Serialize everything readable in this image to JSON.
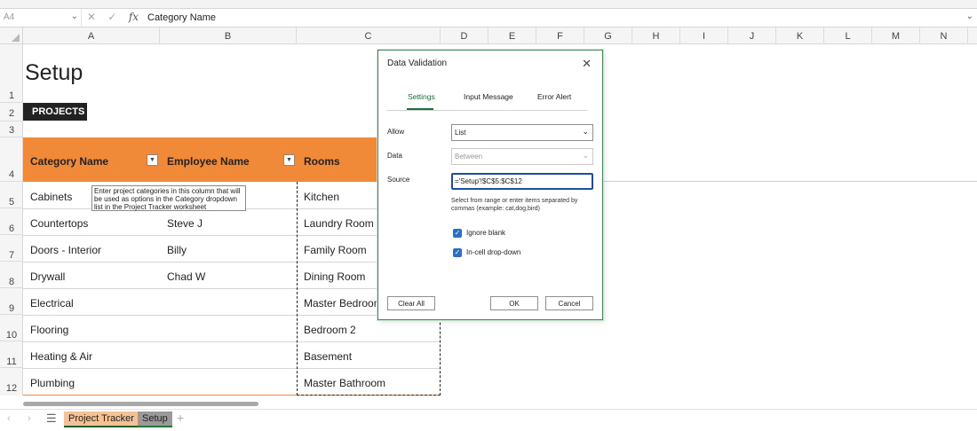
{
  "formula_bar": {
    "cell_ref": "A4",
    "cancel_icon": "x-icon",
    "enter_icon": "checkmark-icon",
    "fx_label": "fx",
    "content": "Category Name"
  },
  "columns": [
    "A",
    "B",
    "C",
    "D",
    "E",
    "F",
    "G",
    "H",
    "I",
    "J",
    "K",
    "L",
    "M",
    "N"
  ],
  "rows": [
    "1",
    "2",
    "3",
    "4",
    "5",
    "6",
    "7",
    "8",
    "9",
    "10",
    "11",
    "12"
  ],
  "sheet": {
    "title": "Setup",
    "section_label": "PROJECTS",
    "table_headers": [
      "Category Name",
      "Employee Name",
      "Rooms"
    ],
    "table_rows": [
      [
        "Cabinets",
        "",
        "Kitchen"
      ],
      [
        "Countertops",
        "Steve J",
        "Laundry Room"
      ],
      [
        "Doors - Interior",
        "Billy",
        "Family Room"
      ],
      [
        "Drywall",
        "Chad W",
        "Dining Room"
      ],
      [
        "Electrical",
        "",
        "Master Bedroom"
      ],
      [
        "Flooring",
        "",
        "Bedroom 2"
      ],
      [
        "Heating & Air",
        "",
        "Basement"
      ],
      [
        "Plumbing",
        "",
        "Master Bathroom"
      ]
    ],
    "comment": "Enter project categories in this column that will be used as options in the Category dropdown list in the Project Tracker worksheet",
    "header_color": "#f08a38"
  },
  "tabs": {
    "items": [
      "Project Tracker",
      "Setup"
    ],
    "active": "Setup",
    "add_label": "+",
    "prev_label": "‹",
    "next_label": "›",
    "menu_label": "☰"
  },
  "dialog": {
    "title": "Data Validation",
    "tabs": [
      "Settings",
      "Input Message",
      "Error Alert"
    ],
    "active_tab": "Settings",
    "allow_label": "Allow",
    "allow_value": "List",
    "data_label": "Data",
    "data_value": "Between",
    "source_label": "Source",
    "source_value": "='Setup'!$C$5:$C$12",
    "help_text": "Select from range or enter items separated by commas (example: cat,dog,bird)",
    "ignore_blank_label": "Ignore blank",
    "ignore_blank_checked": true,
    "in_cell_dropdown_label": "In-cell drop-down",
    "in_cell_dropdown_checked": true,
    "clear_all_label": "Clear All",
    "ok_label": "OK",
    "cancel_label": "Cancel",
    "accent_color": "#1c6e3a"
  }
}
